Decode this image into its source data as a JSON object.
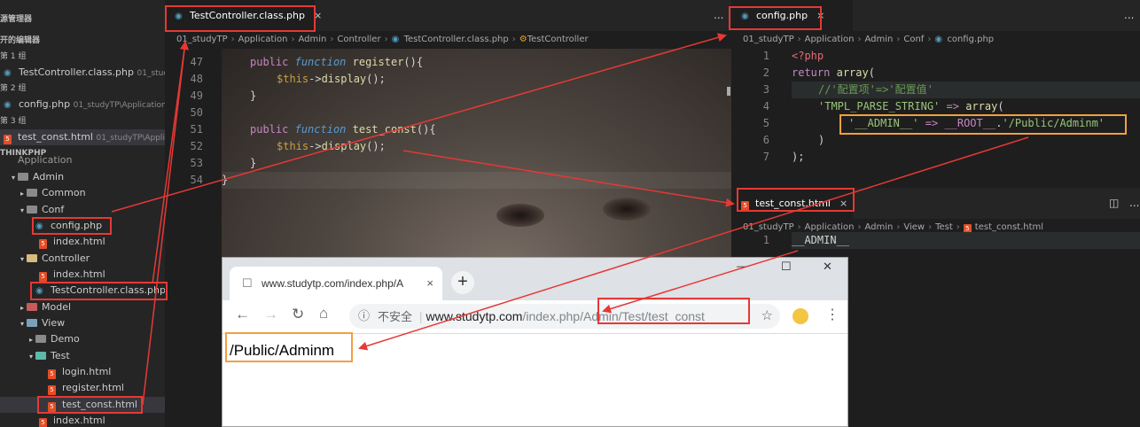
{
  "sidebar": {
    "explorer_title": "源管理器",
    "open_editors_title": "开的编辑器",
    "groups": [
      {
        "label": "第 1 组",
        "file": "TestController.class.php",
        "path": "01_study"
      },
      {
        "label": "第 2 组",
        "file": "config.php",
        "path": "01_studyTP\\Application..."
      },
      {
        "label": "第 3 组",
        "file": "test_const.html",
        "path": "01_studyTP\\Applic..."
      }
    ],
    "project_title": "THINKPHP",
    "project_root": "Application",
    "tree": [
      {
        "label": "Admin",
        "type": "folder",
        "depth": 1
      },
      {
        "label": "Common",
        "type": "folder",
        "depth": 2
      },
      {
        "label": "Conf",
        "type": "folder",
        "depth": 2
      },
      {
        "label": "config.php",
        "type": "php",
        "depth": 3
      },
      {
        "label": "index.html",
        "type": "html",
        "depth": 3
      },
      {
        "label": "Controller",
        "type": "folder",
        "depth": 2
      },
      {
        "label": "index.html",
        "type": "html",
        "depth": 3
      },
      {
        "label": "TestController.class.php",
        "type": "php",
        "depth": 3
      },
      {
        "label": "Model",
        "type": "folder",
        "depth": 2
      },
      {
        "label": "View",
        "type": "folder",
        "depth": 2
      },
      {
        "label": "Demo",
        "type": "folder",
        "depth": 3
      },
      {
        "label": "Test",
        "type": "folder",
        "depth": 3
      },
      {
        "label": "login.html",
        "type": "html",
        "depth": 4
      },
      {
        "label": "register.html",
        "type": "html",
        "depth": 4
      },
      {
        "label": "test_const.html",
        "type": "html",
        "depth": 4
      },
      {
        "label": "index.html",
        "type": "html",
        "depth": 3
      }
    ]
  },
  "editor_left": {
    "tab": "TestController.class.php",
    "close": "×",
    "breadcrumb": [
      "01_studyTP",
      "Application",
      "Admin",
      "Controller",
      "TestController.class.php",
      "TestController"
    ],
    "lines": [
      {
        "num": "47",
        "code": "register"
      },
      {
        "num": "48",
        "code": "display"
      },
      {
        "num": "49",
        "code": "}"
      },
      {
        "num": "50",
        "code": ""
      },
      {
        "num": "51",
        "code": "test_const"
      },
      {
        "num": "52",
        "code": "display"
      },
      {
        "num": "53",
        "code": "}"
      },
      {
        "num": "54",
        "code": "}"
      }
    ],
    "kw_public": "public",
    "kw_function": "function",
    "var_this": "$this",
    "arrow": "->",
    "parens_open": "(){",
    "call_end": "();",
    "more": "..."
  },
  "editor_right_top": {
    "tab": "config.php",
    "close": "×",
    "breadcrumb": [
      "01_studyTP",
      "Application",
      "Admin",
      "Conf",
      "config.php"
    ],
    "line_nums": [
      "1",
      "2",
      "3",
      "4",
      "5",
      "6",
      "7"
    ],
    "l1": "<?php",
    "l2_kw": "return",
    "l2_fn": "array",
    "l2_end": "(",
    "l3": "//'配置项'=>'配置值'",
    "l4_key": "'TMPL_PARSE_STRING'",
    "l4_op": "=>",
    "l4_fn": "array",
    "l4_end": "(",
    "l5_key": "'__ADMIN__'",
    "l5_op": "=>",
    "l5_const": "__ROOT__",
    "l5_dot": ".",
    "l5_val": "'/Public/Adminm'",
    "l6": ")",
    "l7": ");"
  },
  "editor_right_bottom": {
    "tab": "test_const.html",
    "close": "×",
    "breadcrumb": [
      "01_studyTP",
      "Application",
      "Admin",
      "View",
      "Test",
      "test_const.html"
    ],
    "line_num": "1",
    "code": "__ADMIN__"
  },
  "browser": {
    "tab_title": "www.studytp.com/index.php/A",
    "tab_close": "×",
    "new_tab": "+",
    "minimize": "—",
    "maximize": "☐",
    "close": "✕",
    "insecure_label": "不安全",
    "url_host": "www.studytp.com",
    "url_path_a": "/index.php",
    "url_path_b": "/Admin/Test/test_const",
    "page_text": "/Public/Adminm"
  },
  "colors": {
    "annotation_red": "#e53935",
    "annotation_orange": "#f0a040"
  }
}
